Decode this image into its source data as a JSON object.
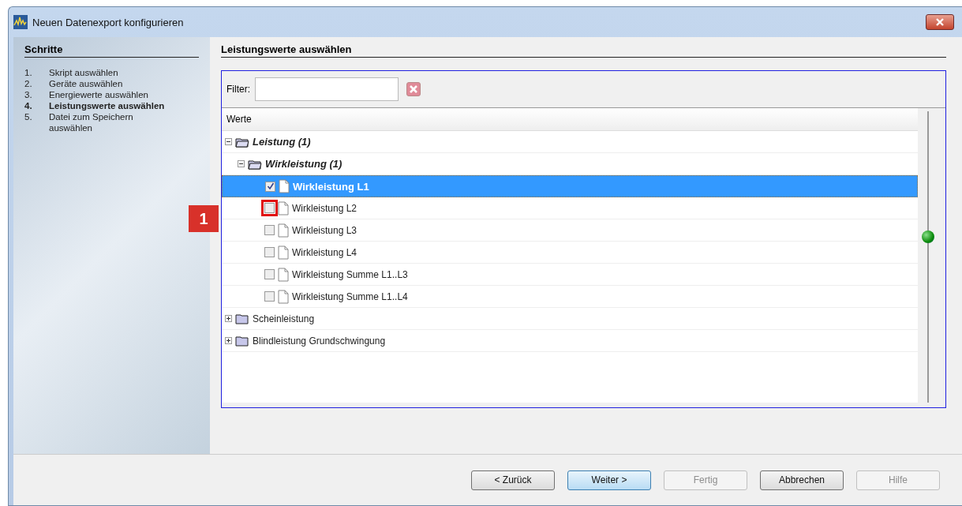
{
  "window": {
    "title": "Neuen Datenexport konfigurieren"
  },
  "steps": {
    "title": "Schritte",
    "items": [
      {
        "number": "1.",
        "label": "Skript auswählen",
        "current": false
      },
      {
        "number": "2.",
        "label": "Geräte auswählen",
        "current": false
      },
      {
        "number": "3.",
        "label": "Energiewerte auswählen",
        "current": false
      },
      {
        "number": "4.",
        "label": "Leistungswerte auswählen",
        "current": true
      },
      {
        "number": "5.",
        "label": "Datei zum Speichern auswählen",
        "current": false
      }
    ]
  },
  "page_title": "Leistungswerte auswählen",
  "filter": {
    "label": "Filter:"
  },
  "tree": {
    "column": "Werte",
    "items": [
      {
        "kind": "folder",
        "label": "Leistung (1)",
        "expanded": true,
        "bold": true,
        "children": [
          {
            "kind": "folder",
            "label": "Wirkleistung (1)",
            "expanded": true,
            "bold": true,
            "children": [
              {
                "kind": "leaf",
                "label": "Wirkleistung L1",
                "checked": true,
                "selected": true
              },
              {
                "kind": "leaf",
                "label": "Wirkleistung L2",
                "checked": false,
                "selected": false,
                "callout": "1"
              },
              {
                "kind": "leaf",
                "label": "Wirkleistung L3",
                "checked": false,
                "selected": false
              },
              {
                "kind": "leaf",
                "label": "Wirkleistung L4",
                "checked": false,
                "selected": false
              },
              {
                "kind": "leaf",
                "label": "Wirkleistung Summe L1..L3",
                "checked": false,
                "selected": false
              },
              {
                "kind": "leaf",
                "label": "Wirkleistung Summe L1..L4",
                "checked": false,
                "selected": false
              }
            ]
          }
        ]
      },
      {
        "kind": "folder",
        "label": "Scheinleistung",
        "expanded": false,
        "bold": false
      },
      {
        "kind": "folder",
        "label": "Blindleistung Grundschwingung",
        "expanded": false,
        "bold": false
      }
    ]
  },
  "buttons": [
    {
      "label": "< Zurück",
      "disabled": false,
      "default": false
    },
    {
      "label": "Weiter >",
      "disabled": false,
      "default": true
    },
    {
      "label": "Fertig",
      "disabled": true,
      "default": false
    },
    {
      "label": "Abbrechen",
      "disabled": false,
      "default": false
    },
    {
      "label": "Hilfe",
      "disabled": true,
      "default": false
    }
  ]
}
